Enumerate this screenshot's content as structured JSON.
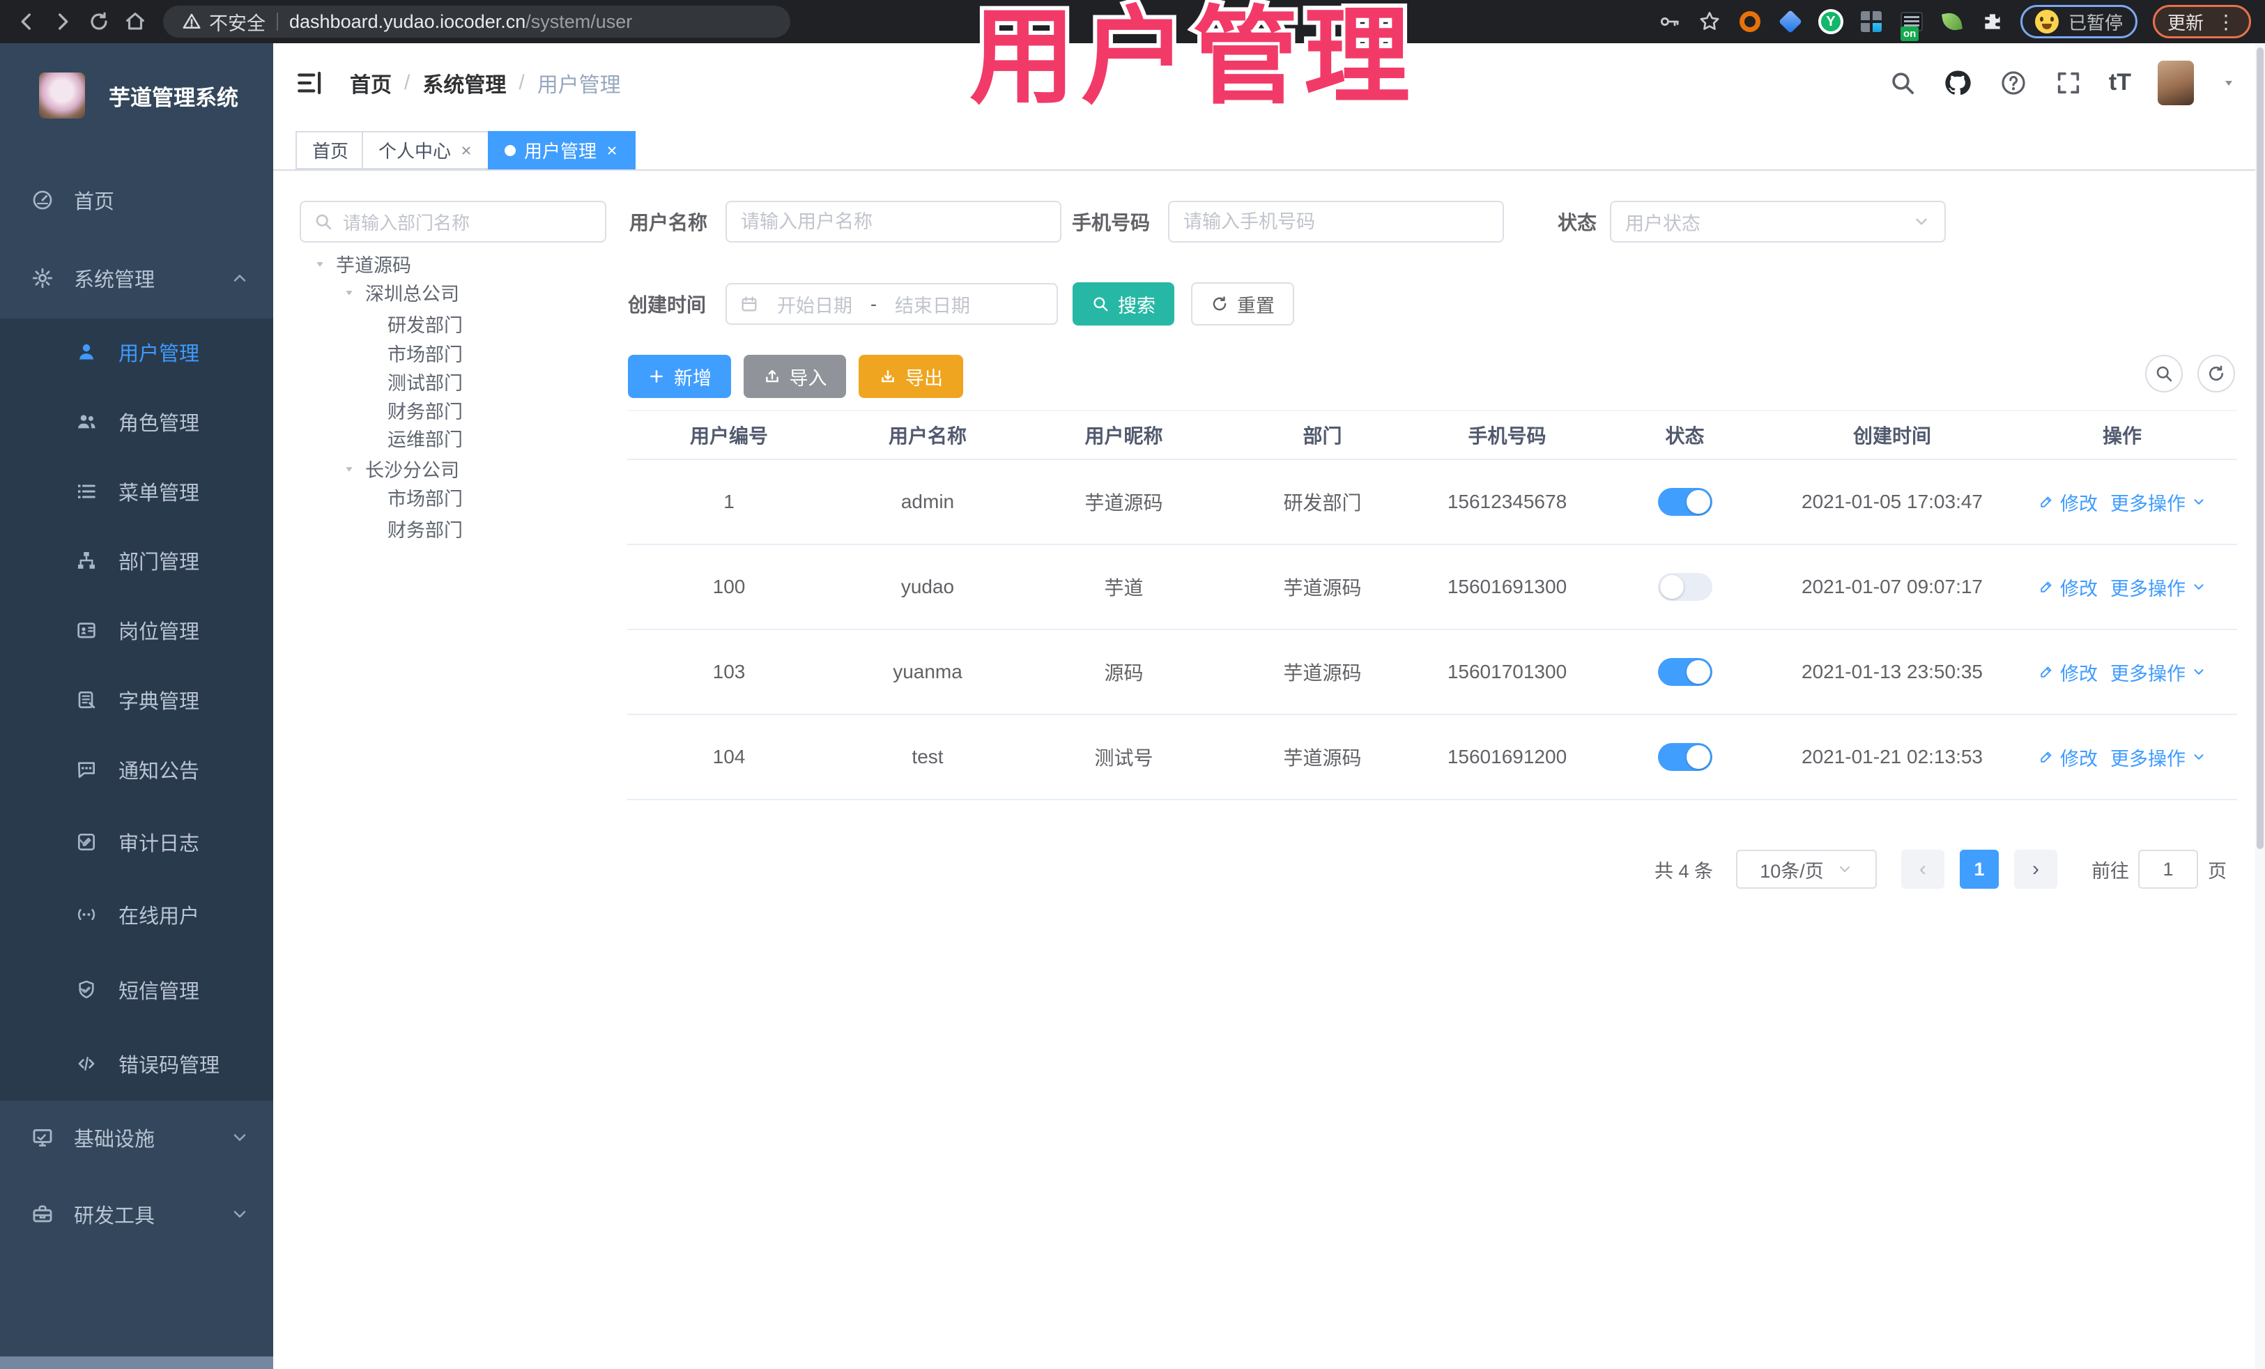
{
  "browser": {
    "security_label": "不安全",
    "url_host": "dashboard.yudao.iocoder.cn",
    "url_path": "/system/user",
    "extension_badge": "on",
    "paused_label": "已暂停",
    "update_label": "更新",
    "menu_dots": "⋮",
    "icons": [
      "back-icon",
      "forward-icon",
      "reload-icon",
      "home-icon",
      "warning-icon",
      "key-icon",
      "star-icon",
      "puzzle-icon"
    ]
  },
  "watermark": {
    "text": "用户管理",
    "color": "#F23A68"
  },
  "sidebar": {
    "app_title": "芋道管理系统",
    "menu": [
      {
        "label": "首页",
        "icon": "gauge-icon"
      },
      {
        "label": "系统管理",
        "icon": "gear-icon",
        "expanded": true
      },
      {
        "label": "基础设施",
        "icon": "monitor-icon",
        "expanded": false
      },
      {
        "label": "研发工具",
        "icon": "toolbox-icon",
        "expanded": false
      }
    ],
    "system_submenu": [
      {
        "label": "用户管理",
        "icon": "user-icon",
        "active": true
      },
      {
        "label": "角色管理",
        "icon": "users-icon"
      },
      {
        "label": "菜单管理",
        "icon": "menu-list-icon"
      },
      {
        "label": "部门管理",
        "icon": "org-tree-icon"
      },
      {
        "label": "岗位管理",
        "icon": "id-badge-icon"
      },
      {
        "label": "字典管理",
        "icon": "dictionary-icon"
      },
      {
        "label": "通知公告",
        "icon": "announcement-icon"
      },
      {
        "label": "审计日志",
        "icon": "audit-log-icon",
        "expandable": true
      },
      {
        "label": "在线用户",
        "icon": "online-users-icon"
      },
      {
        "label": "短信管理",
        "icon": "sms-shield-icon",
        "expandable": true
      },
      {
        "label": "错误码管理",
        "icon": "error-code-icon"
      }
    ]
  },
  "header": {
    "breadcrumb": [
      "首页",
      "系统管理",
      "用户管理"
    ],
    "separator": "/",
    "font_size_icon_text": "tT",
    "icons": [
      "search-icon",
      "github-icon",
      "help-icon",
      "fullscreen-icon",
      "font-size-icon",
      "avatar",
      "caret-down-icon"
    ]
  },
  "tabs": [
    {
      "label": "首页",
      "closable": false,
      "active": false
    },
    {
      "label": "个人中心",
      "closable": true,
      "active": false
    },
    {
      "label": "用户管理",
      "closable": true,
      "active": true
    }
  ],
  "dept_panel": {
    "search_placeholder": "请输入部门名称",
    "tree": [
      {
        "label": "芋道源码",
        "level": 0,
        "expanded": true
      },
      {
        "label": "深圳总公司",
        "level": 1,
        "expanded": true
      },
      {
        "label": "研发部门",
        "level": 2
      },
      {
        "label": "市场部门",
        "level": 2
      },
      {
        "label": "测试部门",
        "level": 2
      },
      {
        "label": "财务部门",
        "level": 2
      },
      {
        "label": "运维部门",
        "level": 2
      },
      {
        "label": "长沙分公司",
        "level": 1,
        "expanded": true
      },
      {
        "label": "市场部门",
        "level": 2
      },
      {
        "label": "财务部门",
        "level": 2
      }
    ]
  },
  "filters": {
    "username_label": "用户名称",
    "username_placeholder": "请输入用户名称",
    "mobile_label": "手机号码",
    "mobile_placeholder": "请输入手机号码",
    "status_label": "状态",
    "status_placeholder": "用户状态",
    "created_label": "创建时间",
    "date_start_placeholder": "开始日期",
    "date_separator": "-",
    "date_end_placeholder": "结束日期",
    "search_label": "搜索",
    "reset_label": "重置"
  },
  "toolbar": {
    "add_label": "新增",
    "import_label": "导入",
    "export_label": "导出"
  },
  "table": {
    "columns": [
      "用户编号",
      "用户名称",
      "用户昵称",
      "部门",
      "手机号码",
      "状态",
      "创建时间",
      "操作"
    ],
    "edit_label": "修改",
    "more_label": "更多操作",
    "rows": [
      {
        "id": "1",
        "username": "admin",
        "nickname": "芋道源码",
        "dept": "研发部门",
        "mobile": "15612345678",
        "status": true,
        "created": "2021-01-05 17:03:47"
      },
      {
        "id": "100",
        "username": "yudao",
        "nickname": "芋道",
        "dept": "芋道源码",
        "mobile": "15601691300",
        "status": false,
        "created": "2021-01-07 09:07:17"
      },
      {
        "id": "103",
        "username": "yuanma",
        "nickname": "源码",
        "dept": "芋道源码",
        "mobile": "15601701300",
        "status": true,
        "created": "2021-01-13 23:50:35"
      },
      {
        "id": "104",
        "username": "test",
        "nickname": "测试号",
        "dept": "芋道源码",
        "mobile": "15601691200",
        "status": true,
        "created": "2021-01-21 02:13:53"
      }
    ]
  },
  "pagination": {
    "total": "共 4 条",
    "page_size": "10条/页",
    "prev": "‹",
    "page": "1",
    "next": "›",
    "goto_label": "前往",
    "goto_value": "1",
    "unit_label": "页"
  },
  "colors": {
    "primary": "#409EFF",
    "search_teal": "#27B8A5",
    "export_warning": "#EFA51F",
    "import_gray": "#909399",
    "sidebar_bg": "#33465B",
    "submenu_bg": "#2A3A4D",
    "watermark_pink": "#F23A68"
  }
}
